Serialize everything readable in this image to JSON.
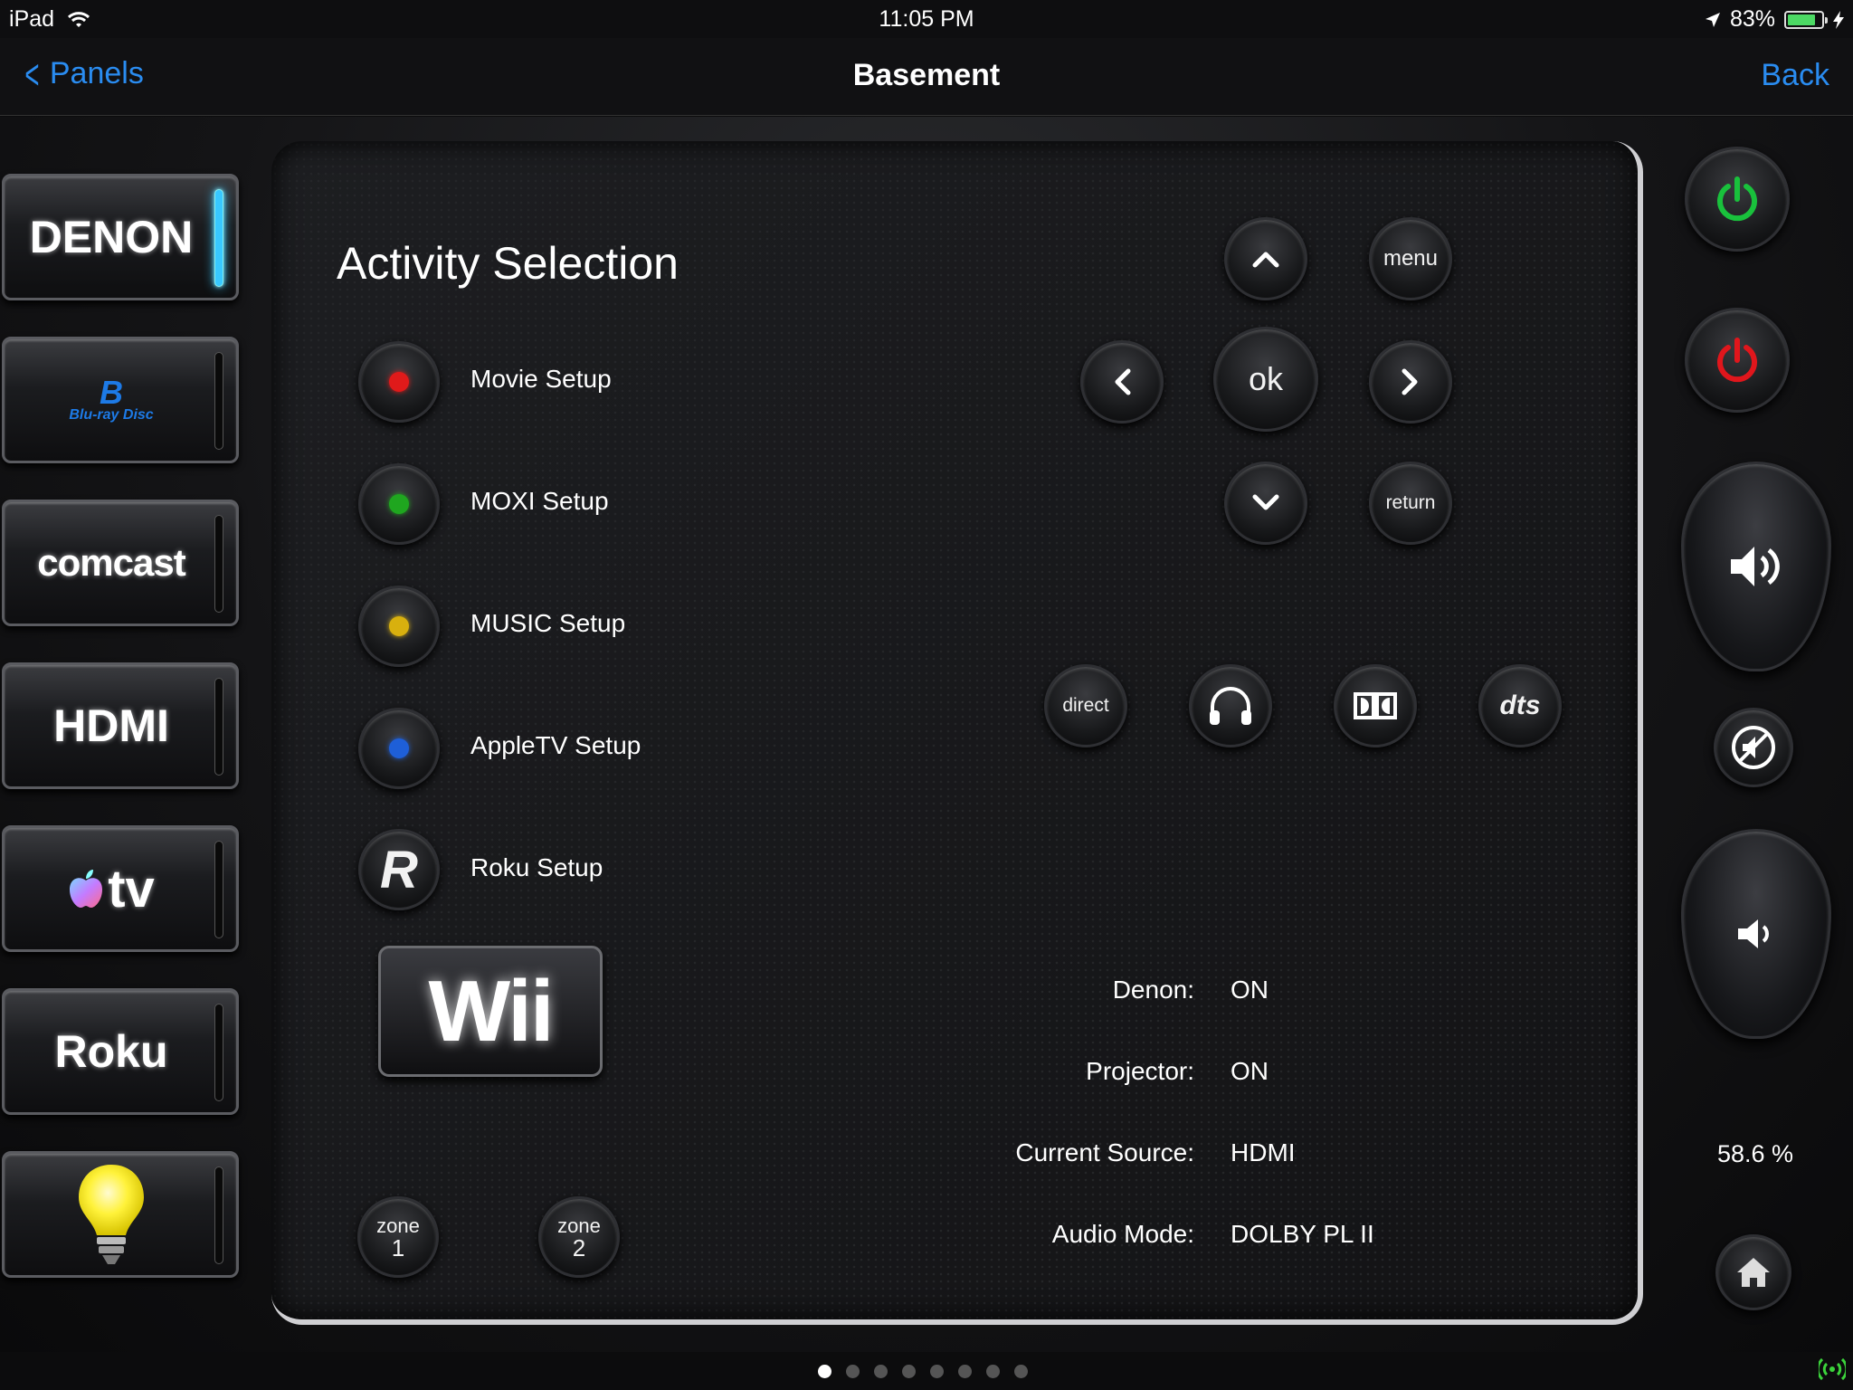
{
  "status_bar": {
    "device": "iPad",
    "time": "11:05 PM",
    "battery": "83%",
    "battery_level": 0.83
  },
  "nav": {
    "back_label": "Panels",
    "title": "Basement",
    "right_label": "Back"
  },
  "sources": [
    {
      "label": "DENON",
      "active": true
    },
    {
      "label": "Blu-ray Disc",
      "active": false
    },
    {
      "label": "comcast",
      "active": false
    },
    {
      "label": "HDMI",
      "active": false
    },
    {
      "label": "tv",
      "active": false
    },
    {
      "label": "Roku",
      "active": false
    },
    {
      "label": "",
      "active": false
    }
  ],
  "activity": {
    "title": "Activity Selection",
    "items": [
      {
        "label": "Movie Setup",
        "color": "#e01a1a"
      },
      {
        "label": "MOXI Setup",
        "color": "#1fa61f"
      },
      {
        "label": "MUSIC Setup",
        "color": "#d8b00e"
      },
      {
        "label": "AppleTV Setup",
        "color": "#1e5fd8"
      },
      {
        "label": "Roku Setup",
        "icon": "R"
      }
    ],
    "wii_label": "Wii"
  },
  "dpad": {
    "menu": "menu",
    "ok": "ok",
    "return": "return"
  },
  "audio_modes": {
    "direct": "direct",
    "dts": "dts"
  },
  "zones": [
    {
      "word": "zone",
      "num": "1"
    },
    {
      "word": "zone",
      "num": "2"
    }
  ],
  "status": [
    {
      "key": "Denon:",
      "value": "ON"
    },
    {
      "key": "Projector:",
      "value": "ON"
    },
    {
      "key": "Current Source:",
      "value": "HDMI"
    },
    {
      "key": "Audio Mode:",
      "value": "DOLBY PL II"
    }
  ],
  "volume": {
    "percent_label": "58.6 %"
  },
  "colors": {
    "accent_blue": "#2a8cf0",
    "power_on": "#19c13c",
    "power_off": "#e0161c",
    "active_glow": "#38c8ff"
  },
  "pager": {
    "total": 8,
    "current": 0
  }
}
